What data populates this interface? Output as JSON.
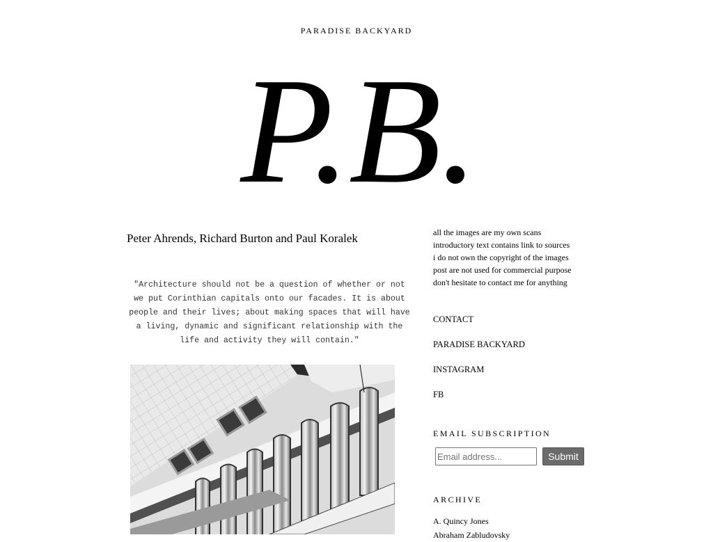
{
  "header": {
    "blog_title": "PARADISE BACKYARD",
    "logo_text": "P.B."
  },
  "post": {
    "title": "Peter Ahrends, Richard Burton and Paul Koralek",
    "quote": "\"Architecture should not be a question of whether or not we put Corinthian capitals onto our facades. It is about people and their lives; about making spaces that will have a living, dynamic and significant relationship with the life and activity they will contain.\""
  },
  "sidebar": {
    "disclaimer": [
      "all the images are my own scans",
      "introductory text contains link to sources",
      "i do not own the copyright of the images",
      "post are not used for commercial purpose",
      "don't hesitate to contact me for anything"
    ],
    "nav_links": [
      "CONTACT",
      "PARADISE BACKYARD",
      "INSTAGRAM",
      "FB"
    ],
    "subscription": {
      "heading": "EMAIL SUBSCRIPTION",
      "email_placeholder": "Email address...",
      "submit_label": "Submit"
    },
    "archive": {
      "heading": "ARCHIVE",
      "items": [
        "A. Quincy Jones",
        "Abraham Zabludovsky"
      ]
    }
  }
}
